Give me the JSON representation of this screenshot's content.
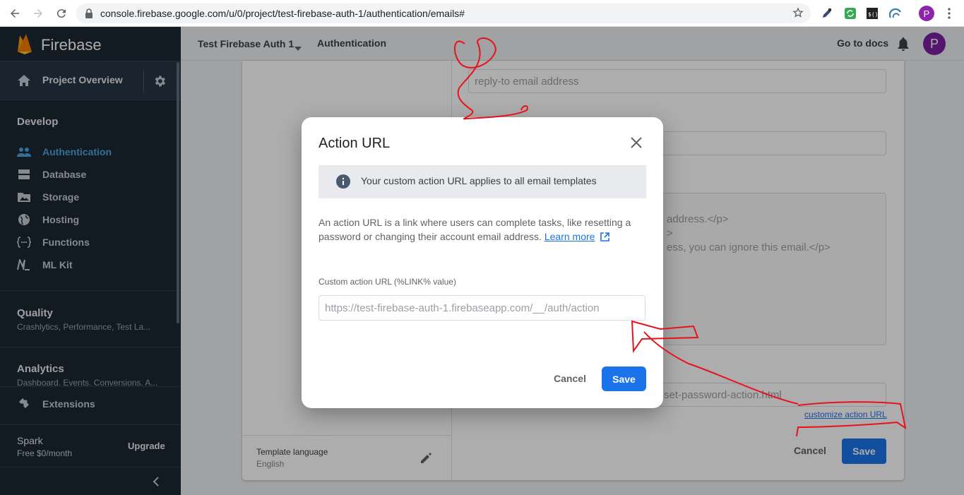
{
  "browser": {
    "url": "console.firebase.google.com/u/0/project/test-firebase-auth-1/authentication/emails#",
    "profile_initial": "P"
  },
  "sidebar": {
    "brand": "Firebase",
    "project_overview": "Project Overview",
    "develop": {
      "title": "Develop",
      "items": [
        {
          "label": "Authentication",
          "icon": "people-icon",
          "active": true
        },
        {
          "label": "Database",
          "icon": "database-icon"
        },
        {
          "label": "Storage",
          "icon": "storage-icon"
        },
        {
          "label": "Hosting",
          "icon": "globe-icon"
        },
        {
          "label": "Functions",
          "icon": "functions-icon"
        },
        {
          "label": "ML Kit",
          "icon": "mlkit-icon"
        }
      ]
    },
    "quality": {
      "title": "Quality",
      "subtitle": "Crashlytics, Performance, Test La..."
    },
    "analytics": {
      "title": "Analytics",
      "subtitle": "Dashboard, Events, Conversions, A..."
    },
    "extensions": "Extensions",
    "plan": {
      "name": "Spark",
      "price": "Free $0/month",
      "upgrade": "Upgrade"
    }
  },
  "topbar": {
    "project": "Test Firebase Auth 1",
    "section": "Authentication",
    "docs": "Go to docs",
    "avatar_initial": "P"
  },
  "background": {
    "reply_to_placeholder": "reply-to email address",
    "body_line1": "address.</p>",
    "body_line2": ">",
    "body_line3": "ess, you can ignore this email.</p>",
    "action_url_fragment": "set-password-action.html",
    "customize_link": "customize action URL",
    "template_language_label": "Template language",
    "template_language_value": "English",
    "cancel": "Cancel",
    "save": "Save"
  },
  "dialog": {
    "title": "Action URL",
    "info": "Your custom action URL applies to all email templates",
    "description": "An action URL is a link where users can complete tasks, like resetting a password or changing their account email address.",
    "learn_more": "Learn more",
    "input_label": "Custom action URL (%LINK% value)",
    "input_placeholder": "https://test-firebase-auth-1.firebaseapp.com/__/auth/action",
    "input_value": "",
    "cancel": "Cancel",
    "save": "Save"
  },
  "colors": {
    "accent": "#1a73e8",
    "sidebar_bg": "#1b2733",
    "active_nav": "#4fa3e0",
    "annotation": "#e8121c"
  }
}
